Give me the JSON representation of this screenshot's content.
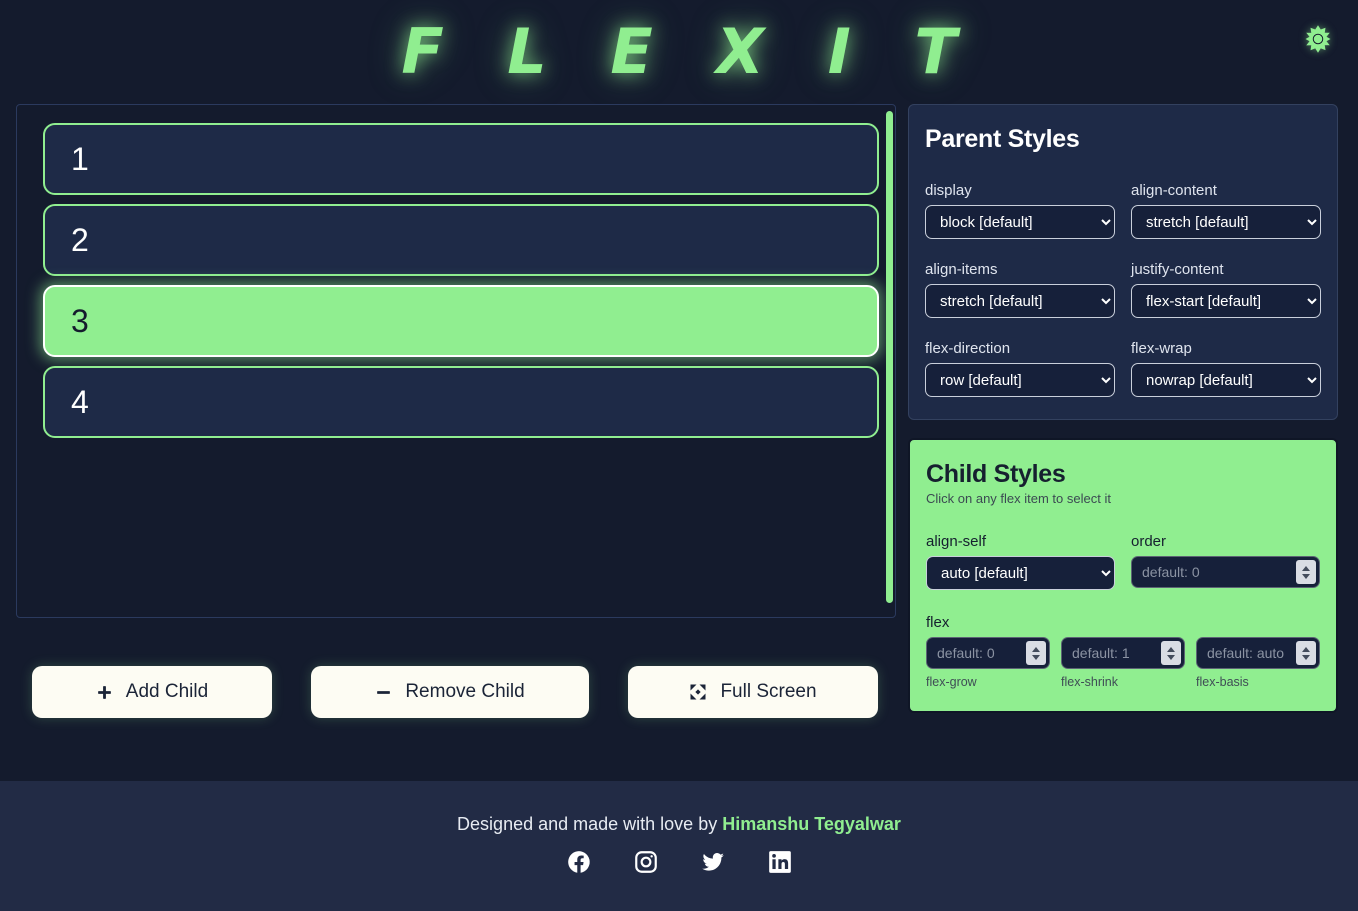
{
  "header": {
    "logo": "F L E X I T",
    "theme_toggle_icon": "sun-icon"
  },
  "flex_preview": {
    "items": [
      {
        "label": "1",
        "selected": false
      },
      {
        "label": "2",
        "selected": false
      },
      {
        "label": "3",
        "selected": true
      },
      {
        "label": "4",
        "selected": false
      }
    ]
  },
  "actions": {
    "add_child": "Add Child",
    "remove_child": "Remove Child",
    "full_screen": "Full Screen"
  },
  "parent_styles": {
    "title": "Parent Styles",
    "fields": [
      {
        "label": "display",
        "value": "block [default]"
      },
      {
        "label": "align-content",
        "value": "stretch [default]"
      },
      {
        "label": "align-items",
        "value": "stretch [default]"
      },
      {
        "label": "justify-content",
        "value": "flex-start [default]"
      },
      {
        "label": "flex-direction",
        "value": "row [default]"
      },
      {
        "label": "flex-wrap",
        "value": "nowrap [default]"
      }
    ]
  },
  "child_styles": {
    "title": "Child Styles",
    "subtitle": "Click on any flex item to select it",
    "align_self": {
      "label": "align-self",
      "value": "auto [default]"
    },
    "order": {
      "label": "order",
      "placeholder": "default: 0",
      "value": ""
    },
    "flex": {
      "label": "flex",
      "inputs": [
        {
          "placeholder": "default: 0",
          "value": "",
          "sublabel": "flex-grow"
        },
        {
          "placeholder": "default: 1",
          "value": "",
          "sublabel": "flex-shrink"
        },
        {
          "placeholder": "default: auto",
          "value": "",
          "sublabel": "flex-basis"
        }
      ]
    }
  },
  "footer": {
    "credit_prefix": "Designed and made with love by ",
    "author": "Himanshu Tegyalwar",
    "social": [
      "facebook-icon",
      "instagram-icon",
      "twitter-icon",
      "linkedin-icon"
    ]
  },
  "colors": {
    "background": "#141b2d",
    "accent_green": "#90ee90",
    "panel_navy": "#1e2a47",
    "footer_navy": "#222b45",
    "button_cream": "#fdfcf3"
  }
}
